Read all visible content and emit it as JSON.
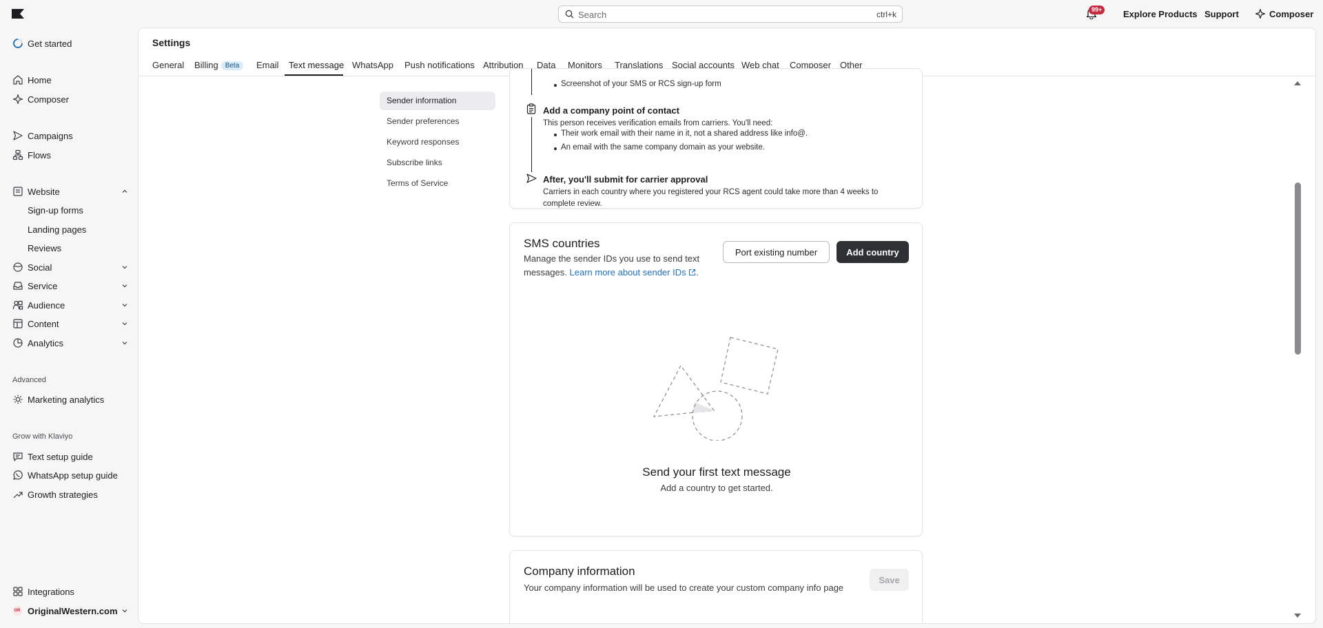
{
  "topbar": {
    "search_placeholder": "Search",
    "search_shortcut": "ctrl+k",
    "notification_badge": "99+",
    "explore_products": "Explore Products",
    "support": "Support",
    "composer": "Composer"
  },
  "sidebar": {
    "get_started": "Get started",
    "home": "Home",
    "composer": "Composer",
    "campaigns": "Campaigns",
    "flows": "Flows",
    "website": "Website",
    "website_sub": [
      "Sign-up forms",
      "Landing pages",
      "Reviews"
    ],
    "social": "Social",
    "service": "Service",
    "audience": "Audience",
    "content": "Content",
    "analytics": "Analytics",
    "advanced_title": "Advanced",
    "marketing_analytics": "Marketing analytics",
    "grow_title": "Grow with Klaviyo",
    "text_setup_guide": "Text setup guide",
    "whatsapp_setup_guide": "WhatsApp setup guide",
    "growth_strategies": "Growth strategies",
    "integrations": "Integrations",
    "account_name": "OriginalWestern.com",
    "account_initials": "OR"
  },
  "settings": {
    "title": "Settings",
    "tabs": [
      "General",
      "Billing",
      "Email",
      "Text message",
      "WhatsApp",
      "Push notifications",
      "Attribution",
      "Data",
      "Monitors",
      "Translations",
      "Social accounts",
      "Web chat",
      "Composer",
      "Other"
    ],
    "beta_label": "Beta",
    "active_tab": "Text message"
  },
  "subnav": {
    "items": [
      "Sender information",
      "Sender preferences",
      "Keyword responses",
      "Subscribe links",
      "Terms of Service"
    ],
    "active": "Sender information"
  },
  "steps_card": {
    "bullet_top": "Screenshot of your SMS or RCS sign-up form",
    "contact_title": "Add a company point of contact",
    "contact_text": "This person receives verification emails from carriers. You'll need:",
    "contact_bullets": [
      "Their work email with their name in it, not a shared address like info@.",
      "An email with the same company domain as your website."
    ],
    "approval_title": "After, you'll submit for carrier approval",
    "approval_text": "Carriers in each country where you registered your RCS agent could take more than 4 weeks to complete review."
  },
  "sms_card": {
    "title": "SMS countries",
    "desc": "Manage the sender IDs you use to send text messages.",
    "learn_more": "Learn more about sender IDs",
    "port_button": "Port existing number",
    "add_button": "Add country",
    "empty_title": "Send your first text message",
    "empty_sub": "Add a country to get started."
  },
  "company_card": {
    "title": "Company information",
    "desc": "Your company information will be used to create your custom company info page",
    "save_button": "Save"
  },
  "colors": {
    "accent_link": "#1f6fbf",
    "dark_button": "#2f3033",
    "badge_red": "#c6283e"
  }
}
